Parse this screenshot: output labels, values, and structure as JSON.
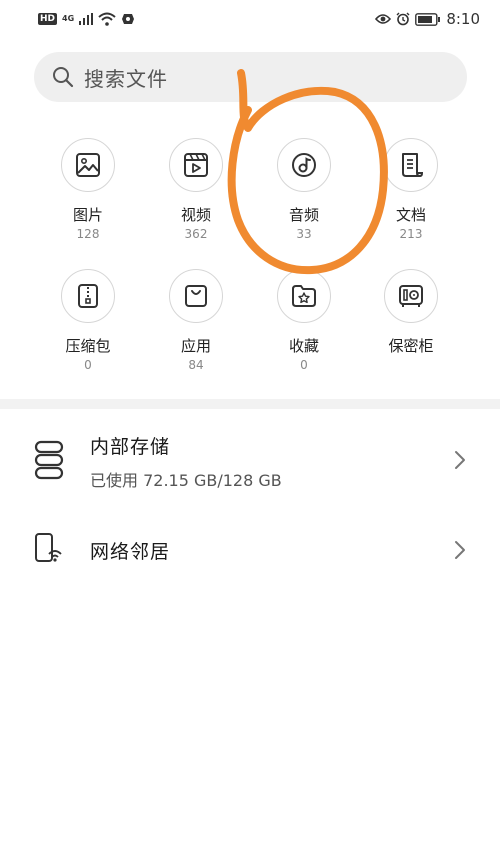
{
  "status_bar": {
    "badge": "HD",
    "network": "4G",
    "time": "8:10"
  },
  "search": {
    "placeholder": "搜索文件",
    "icon": "search-icon"
  },
  "categories": [
    {
      "label": "图片",
      "count": "128",
      "icon": "image-icon"
    },
    {
      "label": "视频",
      "count": "362",
      "icon": "video-icon"
    },
    {
      "label": "音频",
      "count": "33",
      "icon": "audio-icon"
    },
    {
      "label": "文档",
      "count": "213",
      "icon": "document-icon"
    },
    {
      "label": "压缩包",
      "count": "0",
      "icon": "archive-icon"
    },
    {
      "label": "应用",
      "count": "84",
      "icon": "app-bag-icon"
    },
    {
      "label": "收藏",
      "count": "0",
      "icon": "favorite-folder-icon"
    },
    {
      "label": "保密柜",
      "count": "",
      "icon": "safe-icon"
    }
  ],
  "storage": {
    "internal": {
      "title": "内部存储",
      "usage": "已使用 72.15 GB/128 GB",
      "icon": "storage-icon"
    },
    "network": {
      "title": "网络邻居",
      "icon": "network-neighbor-icon"
    }
  },
  "colors": {
    "annotation": "#f08a30",
    "icon_stroke": "#333333"
  }
}
